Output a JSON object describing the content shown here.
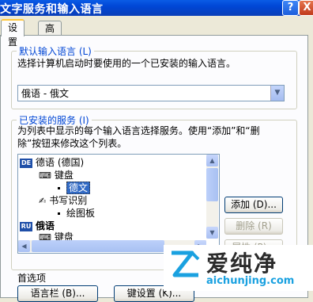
{
  "window": {
    "title": "文字服务和输入语言",
    "help_label": "?",
    "close_label": "X"
  },
  "tabs": [
    {
      "label": "设置",
      "active": true
    },
    {
      "label": "高级",
      "active": false
    }
  ],
  "default_language": {
    "group_label": "默认输入语言 (L)",
    "description": "选择计算机启动时要使用的一个已安装的输入语言。",
    "selected_value": "俄语 - 俄文"
  },
  "installed_services": {
    "group_label": "已安装的服务 (I)",
    "description_line1": "为列表中显示的每个输入语言选择服务。使用“添加”和“删",
    "description_line2": "除”按钮来修改这个列表。",
    "tree": [
      {
        "badge": "DE",
        "label": "德语 (德国)"
      },
      {
        "icon": "keyboard-icon",
        "label": "键盘"
      },
      {
        "label": "德文",
        "selected": true
      },
      {
        "icon": "pen-icon",
        "label": "书写识别"
      },
      {
        "label": "绘图板"
      },
      {
        "badge": "RU",
        "label": "俄语"
      },
      {
        "icon": "keyboard-icon",
        "label": "键盘"
      }
    ],
    "buttons": {
      "add": "添加 (D)...",
      "remove": "删除 (R)",
      "properties": "属性 (P)..."
    }
  },
  "preferences": {
    "group_label": "首选项",
    "button1": "语言栏 (B)...",
    "button2": "键设置 (K)..."
  },
  "watermark": {
    "title": "爱纯净",
    "url": "aichunjing.com"
  }
}
